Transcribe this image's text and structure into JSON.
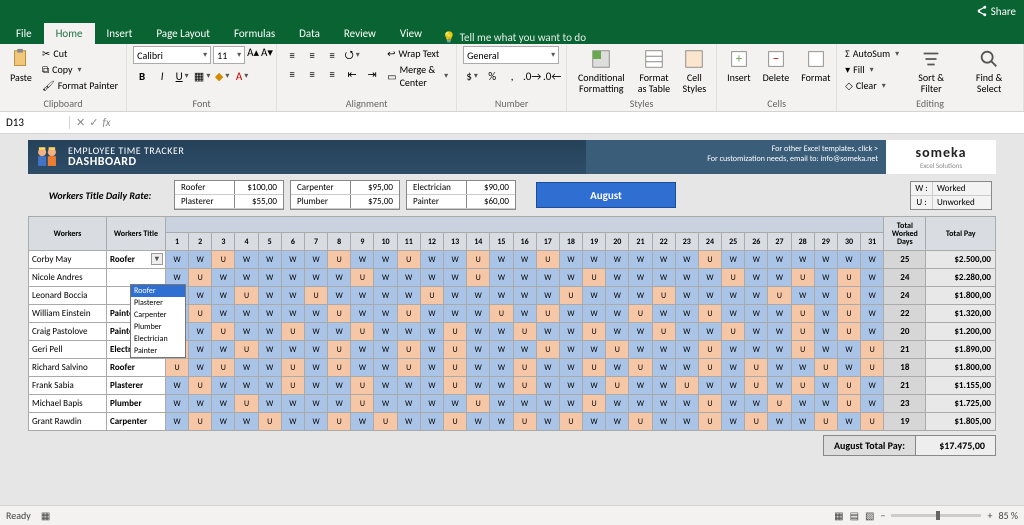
{
  "titlebar": {
    "share": "Share"
  },
  "tabs": {
    "file": "File",
    "home": "Home",
    "insert": "Insert",
    "pageLayout": "Page Layout",
    "formulas": "Formulas",
    "data": "Data",
    "review": "Review",
    "view": "View",
    "tellMe": "Tell me what you want to do"
  },
  "ribbon": {
    "clipboard": {
      "paste": "Paste",
      "cut": "Cut",
      "copy": "Copy",
      "formatPainter": "Format Painter",
      "label": "Clipboard"
    },
    "font": {
      "name": "Calibri",
      "size": "11",
      "label": "Font"
    },
    "alignment": {
      "wrap": "Wrap Text",
      "merge": "Merge & Center",
      "label": "Alignment"
    },
    "number": {
      "format": "General",
      "label": "Number"
    },
    "styles": {
      "cond": "Conditional\nFormatting",
      "table": "Format as\nTable",
      "cell": "Cell\nStyles",
      "label": "Styles"
    },
    "cells": {
      "insert": "Insert",
      "delete": "Delete",
      "format": "Format",
      "label": "Cells"
    },
    "editing": {
      "autosum": "AutoSum",
      "fill": "Fill",
      "clear": "Clear",
      "sort": "Sort &\nFilter",
      "find": "Find &\nSelect",
      "label": "Editing"
    }
  },
  "formula": {
    "cell": "D13",
    "fx": "fx"
  },
  "dash": {
    "title1": "EMPLOYEE TIME TRACKER",
    "title2": "DASHBOARD",
    "notice1": "For other Excel templates, click >",
    "notice2": "For customization needs, email to: info@someka.net",
    "logo": "someka",
    "logoSub": "Excel Solutions",
    "ratesLabel": "Workers Title Daily Rate:",
    "rates": [
      [
        {
          "t": "Roofer",
          "v": "$100,00"
        },
        {
          "t": "Plasterer",
          "v": "$55,00"
        }
      ],
      [
        {
          "t": "Carpenter",
          "v": "$95,00"
        },
        {
          "t": "Plumber",
          "v": "$75,00"
        }
      ],
      [
        {
          "t": "Electrician",
          "v": "$90,00"
        },
        {
          "t": "Painter",
          "v": "$60,00"
        }
      ]
    ],
    "month": "August",
    "legend": [
      {
        "k": "W :",
        "v": "Worked"
      },
      {
        "k": "U :",
        "v": "Unworked"
      }
    ],
    "cols": {
      "workers": "Workers",
      "title": "Workers Title",
      "daysTotal": "Total Worked Days",
      "pay": "Total Pay"
    },
    "days": [
      "1",
      "2",
      "3",
      "4",
      "5",
      "6",
      "7",
      "8",
      "9",
      "10",
      "11",
      "12",
      "13",
      "14",
      "15",
      "16",
      "17",
      "18",
      "19",
      "20",
      "21",
      "22",
      "23",
      "24",
      "25",
      "26",
      "27",
      "28",
      "29",
      "30",
      "31"
    ],
    "rows": [
      {
        "name": "Corby May",
        "title": "Roofer",
        "dd": true,
        "d": [
          "W",
          "W",
          "U",
          "W",
          "W",
          "W",
          "W",
          "U",
          "W",
          "W",
          "U",
          "W",
          "W",
          "U",
          "W",
          "W",
          "U",
          "W",
          "W",
          "W",
          "W",
          "W",
          "W",
          "U",
          "W",
          "W",
          "W",
          "W",
          "W",
          "W",
          "W"
        ],
        "days": "25",
        "pay": "$2.500,00"
      },
      {
        "name": "Nicole Andres",
        "title": "",
        "d": [
          "W",
          "U",
          "W",
          "W",
          "W",
          "W",
          "W",
          "W",
          "U",
          "W",
          "W",
          "W",
          "W",
          "U",
          "W",
          "W",
          "W",
          "W",
          "U",
          "W",
          "W",
          "W",
          "W",
          "W",
          "U",
          "W",
          "W",
          "U",
          "W",
          "U",
          "W"
        ],
        "days": "24",
        "pay": "$2.280,00"
      },
      {
        "name": "Leonard Boccia",
        "title": "",
        "d": [
          "W",
          "W",
          "W",
          "U",
          "W",
          "W",
          "U",
          "W",
          "W",
          "W",
          "W",
          "U",
          "W",
          "W",
          "W",
          "W",
          "W",
          "U",
          "W",
          "W",
          "W",
          "U",
          "W",
          "W",
          "W",
          "W",
          "U",
          "W",
          "W",
          "U",
          "W"
        ],
        "days": "24",
        "pay": "$1.800,00"
      },
      {
        "name": "William Einstein",
        "title": "Painter",
        "d": [
          "W",
          "U",
          "W",
          "W",
          "W",
          "W",
          "W",
          "U",
          "W",
          "W",
          "U",
          "W",
          "W",
          "W",
          "U",
          "W",
          "U",
          "W",
          "W",
          "W",
          "U",
          "W",
          "W",
          "U",
          "W",
          "W",
          "W",
          "U",
          "W",
          "U",
          "W"
        ],
        "days": "22",
        "pay": "$1.320,00"
      },
      {
        "name": "Craig Pastolove",
        "title": "Painter",
        "d": [
          "W",
          "W",
          "U",
          "W",
          "W",
          "U",
          "W",
          "W",
          "U",
          "W",
          "W",
          "W",
          "U",
          "W",
          "W",
          "U",
          "W",
          "W",
          "U",
          "W",
          "W",
          "U",
          "W",
          "W",
          "U",
          "W",
          "W",
          "U",
          "W",
          "U",
          "W"
        ],
        "days": "20",
        "pay": "$1.200,00"
      },
      {
        "name": "Geri Pell",
        "title": "Electrician",
        "d": [
          "U",
          "W",
          "W",
          "U",
          "W",
          "W",
          "W",
          "U",
          "W",
          "W",
          "U",
          "W",
          "U",
          "W",
          "W",
          "W",
          "U",
          "W",
          "W",
          "U",
          "W",
          "W",
          "W",
          "U",
          "W",
          "W",
          "W",
          "U",
          "W",
          "W",
          "U"
        ],
        "days": "21",
        "pay": "$1.890,00"
      },
      {
        "name": "Richard Salvino",
        "title": "Roofer",
        "d": [
          "U",
          "W",
          "U",
          "W",
          "W",
          "U",
          "W",
          "U",
          "W",
          "W",
          "U",
          "W",
          "U",
          "W",
          "W",
          "U",
          "W",
          "W",
          "U",
          "W",
          "U",
          "W",
          "W",
          "U",
          "W",
          "U",
          "W",
          "W",
          "U",
          "W",
          "U"
        ],
        "days": "18",
        "pay": "$1.800,00"
      },
      {
        "name": "Frank Sabia",
        "title": "Plasterer",
        "d": [
          "W",
          "U",
          "W",
          "W",
          "W",
          "U",
          "W",
          "W",
          "U",
          "W",
          "W",
          "W",
          "U",
          "W",
          "W",
          "U",
          "W",
          "W",
          "W",
          "U",
          "W",
          "W",
          "U",
          "W",
          "W",
          "U",
          "W",
          "U",
          "W",
          "U",
          "W"
        ],
        "days": "21",
        "pay": "$1.155,00"
      },
      {
        "name": "Michael Bapis",
        "title": "Plumber",
        "d": [
          "W",
          "W",
          "W",
          "U",
          "W",
          "W",
          "W",
          "W",
          "U",
          "W",
          "W",
          "W",
          "W",
          "U",
          "W",
          "W",
          "W",
          "W",
          "U",
          "W",
          "W",
          "W",
          "W",
          "U",
          "W",
          "W",
          "U",
          "W",
          "W",
          "U",
          "W"
        ],
        "days": "23",
        "pay": "$1.725,00"
      },
      {
        "name": "Grant Rawdin",
        "title": "Carpenter",
        "d": [
          "W",
          "U",
          "W",
          "W",
          "U",
          "W",
          "W",
          "U",
          "W",
          "U",
          "W",
          "W",
          "U",
          "W",
          "W",
          "U",
          "W",
          "U",
          "W",
          "W",
          "U",
          "W",
          "W",
          "U",
          "W",
          "U",
          "W",
          "W",
          "U",
          "W",
          "U"
        ],
        "days": "19",
        "pay": "$1.805,00"
      }
    ],
    "dropdown": [
      "Roofer",
      "Plasterer",
      "Carpenter",
      "Plumber",
      "Electrician",
      "Painter"
    ],
    "totalLabel": "August Total Pay:",
    "totalValue": "$17.475,00"
  },
  "status": {
    "ready": "Ready",
    "zoom": "85 %"
  }
}
